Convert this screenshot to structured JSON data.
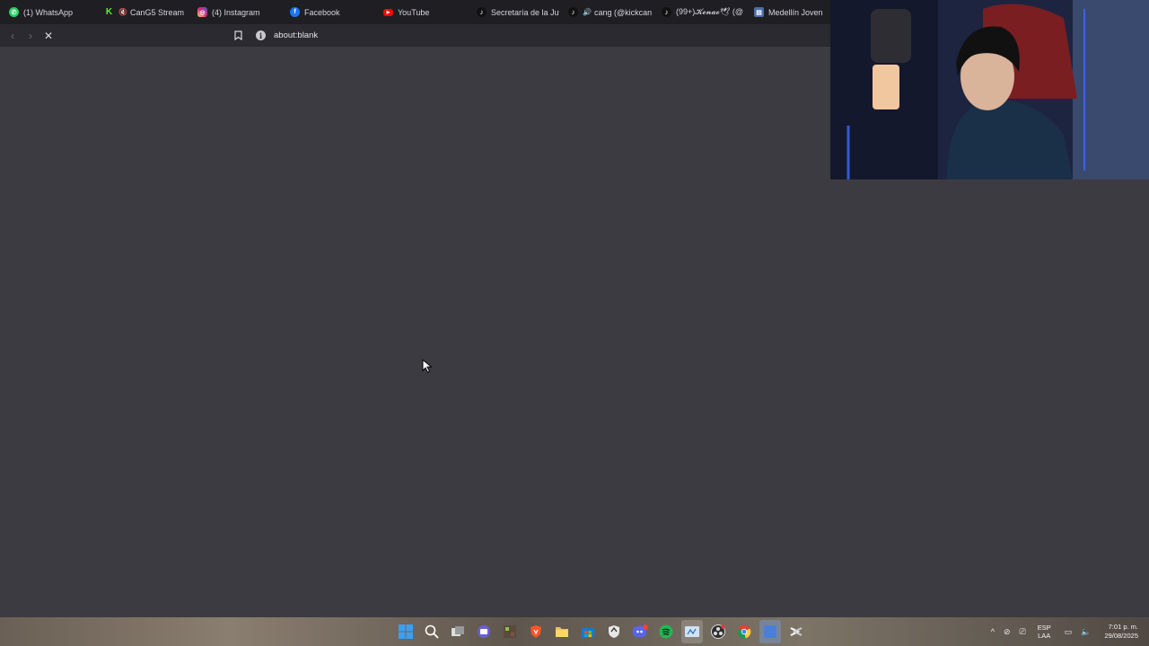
{
  "tabs": [
    {
      "label": "(1) WhatsApp",
      "icon": "whatsapp-icon",
      "color": "#25d366"
    },
    {
      "label": "CanG5 Stream",
      "icon": "kick-icon",
      "color": "#53fc18",
      "muted": true
    },
    {
      "label": "(4) Instagram",
      "icon": "instagram-icon",
      "color": "#d6249f"
    },
    {
      "label": "Facebook",
      "icon": "facebook-icon",
      "color": "#1877f2"
    },
    {
      "label": "YouTube",
      "icon": "youtube-icon",
      "color": "#ff0000"
    },
    {
      "label": "Secretaría de la Juv",
      "icon": "tiktok-icon",
      "color": "#111111"
    },
    {
      "label": "cang (@kickcan",
      "icon": "tiktok-icon",
      "color": "#111111",
      "muted": true
    },
    {
      "label": "(99+)𝓚𝓮𝓷𝓪𝓸🕊 (@",
      "icon": "tiktok-icon",
      "color": "#111111"
    },
    {
      "label": "Medellín Joven",
      "icon": "site-icon",
      "color": "#4a6fa5"
    }
  ],
  "address": {
    "url": "about:blank"
  },
  "taskbar": {
    "apps": [
      "windows-start-icon",
      "search-icon",
      "task-view-icon",
      "chat-icon",
      "minecraft-icon",
      "brave-icon",
      "file-explorer-icon",
      "microsoft-store-icon",
      "app-shield-icon",
      "discord-icon",
      "spotify-icon",
      "app-window-icon",
      "obs-icon",
      "chrome-icon",
      "app-blue-icon",
      "app-capcut-icon"
    ],
    "lang_line1": "ESP",
    "lang_line2": "LAA",
    "time": "7:01 p. m.",
    "date": "29/08/2025"
  },
  "colors": {
    "background": "#3c3b41",
    "tabbar": "#1f1e23",
    "toolbar": "#2b2a30"
  }
}
